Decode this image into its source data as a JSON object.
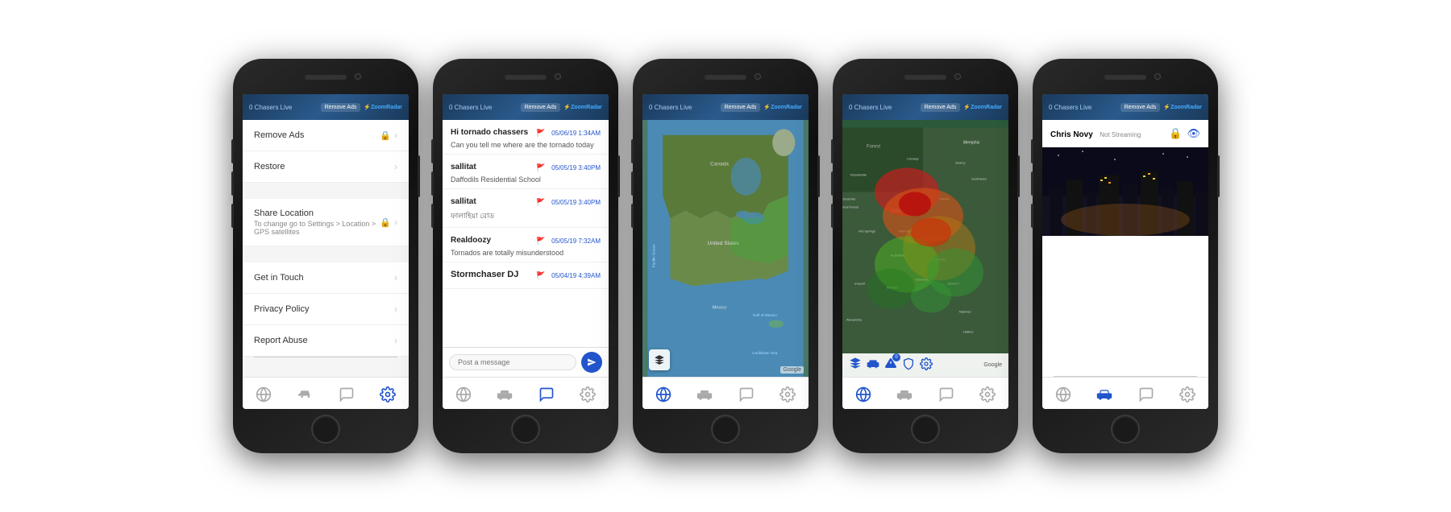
{
  "phones": [
    {
      "id": "phone-1",
      "screen": "menu",
      "header": {
        "chasers": "0 Chasers Live",
        "removeAds": "Remove Ads",
        "logo": "ZoomRadar"
      },
      "menu": {
        "items": [
          {
            "label": "Remove Ads",
            "type": "lock-chevron"
          },
          {
            "label": "Restore",
            "type": "chevron"
          },
          {
            "label": "Share Location",
            "type": "lock-chevron",
            "sub": "To change go to Settings > Location > GPS satellites"
          },
          {
            "label": "Get in Touch",
            "type": "chevron"
          },
          {
            "label": "Privacy Policy",
            "type": "chevron"
          },
          {
            "label": "Report Abuse",
            "type": "chevron"
          }
        ]
      },
      "tabs": [
        {
          "icon": "🌐",
          "active": false
        },
        {
          "icon": "🚗",
          "active": false
        },
        {
          "icon": "💬",
          "active": false
        },
        {
          "icon": "⚙️",
          "active": true
        }
      ]
    },
    {
      "id": "phone-2",
      "screen": "chat",
      "header": {
        "chasers": "0 Chasers Live",
        "removeAds": "Remove Ads",
        "logo": "ZoomRadar"
      },
      "messages": [
        {
          "username": "Hi tornado chassers",
          "flag": "🚩",
          "timestamp": "05/06/19 1:34AM",
          "bold": true,
          "text": "Can you tell me where are the tornado today"
        },
        {
          "username": "sallitat",
          "flag": "🚩",
          "timestamp": "05/05/19 3:40PM",
          "text": "Daffodils Residential School"
        },
        {
          "username": "sallitat",
          "flag": "🚩",
          "timestamp": "05/05/19 3:40PM",
          "text": "ফালাহিয়া রোড"
        },
        {
          "username": "Realdoozy",
          "flag": "🚩",
          "timestamp": "05/05/19 7:32AM",
          "text": "Tornados are totally misunderstood"
        },
        {
          "username": "Stormchaser DJ",
          "flag": "🚩",
          "timestamp": "05/04/19 4:39AM",
          "bold": true,
          "text": ""
        }
      ],
      "input_placeholder": "Post a message",
      "tabs": [
        {
          "icon": "🌐",
          "active": false
        },
        {
          "icon": "🚗",
          "active": false
        },
        {
          "icon": "💬",
          "active": true
        },
        {
          "icon": "⚙️",
          "active": false
        }
      ]
    },
    {
      "id": "phone-3",
      "screen": "map",
      "header": {
        "chasers": "0 Chasers Live",
        "removeAds": "Remove Ads",
        "logo": "ZoomRadar"
      },
      "tabs": [
        {
          "icon": "🌐",
          "active": true
        },
        {
          "icon": "🚗",
          "active": false
        },
        {
          "icon": "💬",
          "active": false
        },
        {
          "icon": "⚙️",
          "active": false
        }
      ]
    },
    {
      "id": "phone-4",
      "screen": "radar",
      "header": {
        "chasers": "0 Chasers Live",
        "removeAds": "Remove Ads",
        "logo": "ZoomRadar"
      },
      "tabs": [
        {
          "icon": "🌐",
          "active": true
        },
        {
          "icon": "🚗",
          "active": false
        },
        {
          "icon": "💬",
          "active": false
        },
        {
          "icon": "⚙️",
          "active": false
        }
      ]
    },
    {
      "id": "phone-5",
      "screen": "stream",
      "header": {
        "chasers": "0 Chasers Live",
        "removeAds": "Remove Ads",
        "logo": "ZoomRadar"
      },
      "stream": {
        "username": "Chris Novy",
        "status": "Not Streaming"
      },
      "tabs": [
        {
          "icon": "🌐",
          "active": false
        },
        {
          "icon": "🚗",
          "active": true
        },
        {
          "icon": "💬",
          "active": false
        },
        {
          "icon": "⚙️",
          "active": false
        }
      ]
    }
  ],
  "labels": {
    "removeAds": "Remove Ads",
    "restore": "Restore",
    "shareLocation": "Share Location",
    "shareLocationSub": "To change go to Settings > Location > GPS satellites",
    "getInTouch": "Get in Touch",
    "privacyPolicy": "Privacy Policy",
    "reportAbuse": "Report Abuse",
    "google": "Google",
    "postMessage": "Post a message"
  }
}
